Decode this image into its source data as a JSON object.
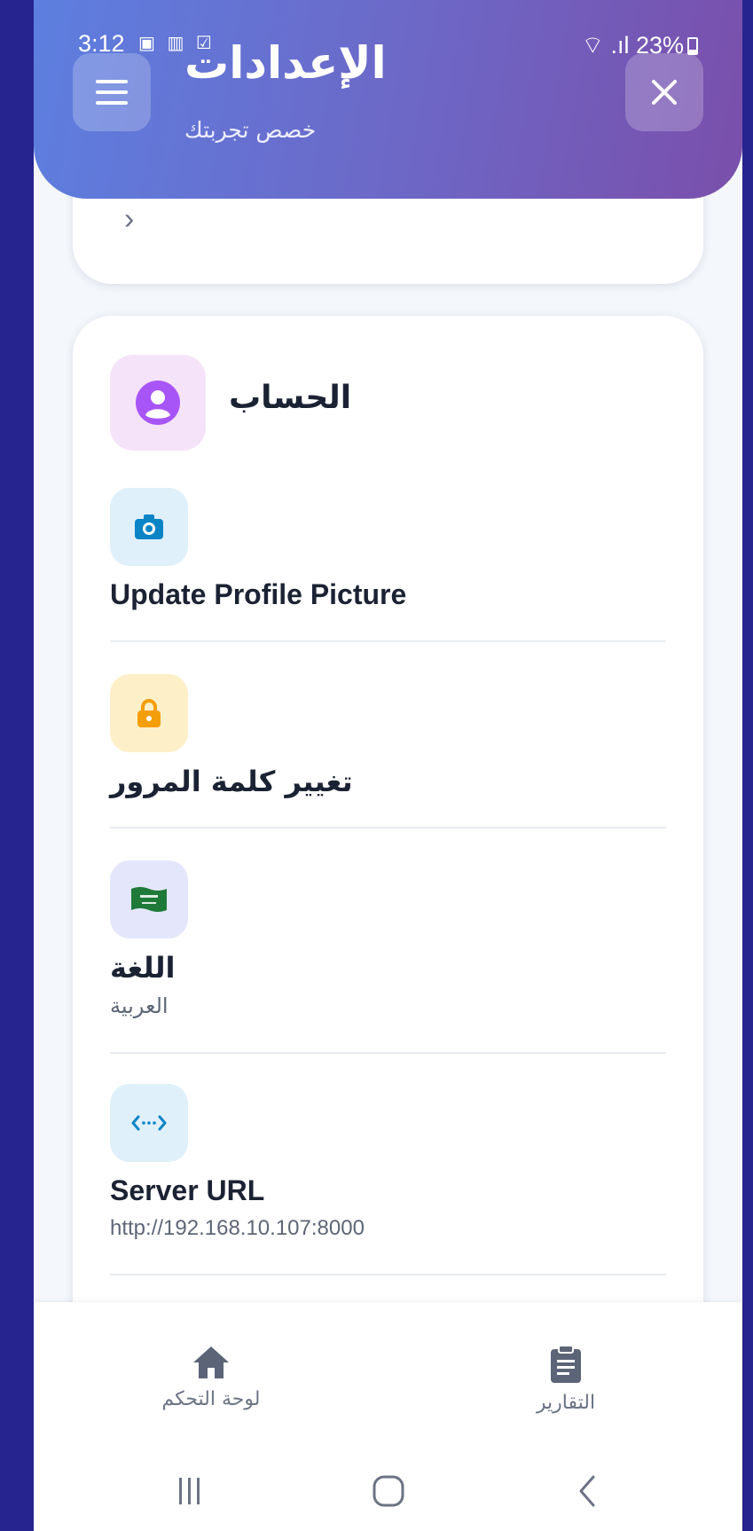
{
  "status_bar": {
    "time": "3:12",
    "battery": "23%"
  },
  "header": {
    "title": "الإعدادات",
    "subtitle": "خصص تجربتك"
  },
  "section": {
    "title": "الحساب"
  },
  "rows": [
    {
      "title": "Update Profile Picture",
      "icon": "camera-icon",
      "color": "#0b84c6",
      "bg": "#dff0fb"
    },
    {
      "title": "تغيير كلمة المرور",
      "icon": "lock-icon",
      "color": "#f59e0b",
      "bg": "#fdf0c9"
    },
    {
      "title": "اللغة",
      "subtitle": "العربية",
      "icon": "saudi-flag-icon",
      "bg": "#e4e6fb"
    },
    {
      "title": "Server URL",
      "subtitle": "http://192.168.10.107:8000",
      "icon": "code-brackets-icon",
      "color": "#0b84c6",
      "bg": "#dff0fb"
    }
  ],
  "bottom_nav": {
    "dashboard_label": "لوحة التحكم",
    "reports_label": "التقارير"
  },
  "colors": {
    "accent_start": "#5d7fe0",
    "accent_end": "#7a4fab",
    "section_icon": "#a855f7"
  }
}
